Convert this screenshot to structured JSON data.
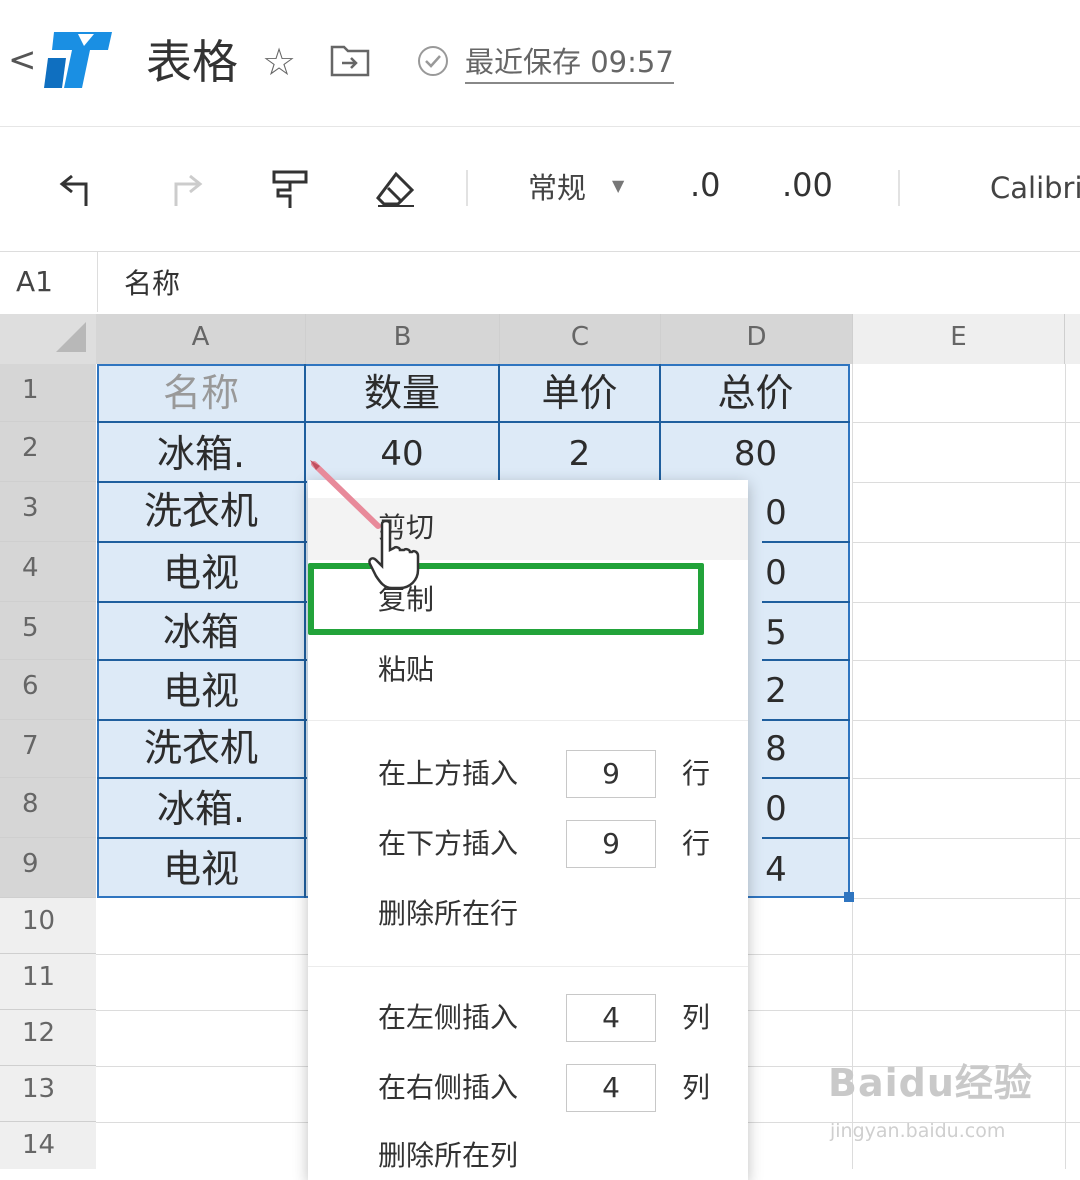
{
  "title_bar": {
    "back": "<",
    "doc_title": "表格",
    "saved_text": "最近保存 09:57"
  },
  "toolbar": {
    "number_format": "常规",
    "decrease_decimal": ".0",
    "increase_decimal": ".00",
    "font": "Calibri"
  },
  "formula_bar": {
    "cell_ref": "A1",
    "value": "名称"
  },
  "sheet": {
    "columns": [
      "A",
      "B",
      "C",
      "D",
      "E"
    ],
    "rows": [
      "1",
      "2",
      "3",
      "4",
      "5",
      "6",
      "7",
      "8",
      "9",
      "10",
      "11",
      "12",
      "13",
      "14"
    ],
    "headers": {
      "a": "名称",
      "b": "数量",
      "c": "单价",
      "d": "总价"
    },
    "row2": {
      "b": "40",
      "c": "2",
      "d": "80"
    },
    "col_a": [
      "冰箱.",
      "洗衣机",
      "电视",
      "冰箱",
      "电视",
      "洗衣机",
      "冰箱.",
      "电视"
    ],
    "col_d_visible": [
      "0",
      "0",
      "5",
      "2",
      "8",
      "0",
      "4"
    ]
  },
  "context_menu": {
    "cut": "剪切",
    "copy": "复制",
    "paste": "粘贴",
    "insert_above": "在上方插入",
    "insert_above_count": "9",
    "insert_below": "在下方插入",
    "insert_below_count": "9",
    "row_unit": "行",
    "delete_row": "删除所在行",
    "insert_left": "在左侧插入",
    "insert_left_count": "4",
    "insert_right": "在右侧插入",
    "insert_right_count": "4",
    "col_unit": "列",
    "delete_col": "删除所在列"
  },
  "watermark": {
    "logo": "Baidu经验",
    "url": "jingyan.baidu.com"
  },
  "colors": {
    "selection_fill": "#ddeaf7",
    "selection_border": "#2f75c0",
    "highlight_box": "#22a33a",
    "logo_blue": "#1a8fe3"
  }
}
